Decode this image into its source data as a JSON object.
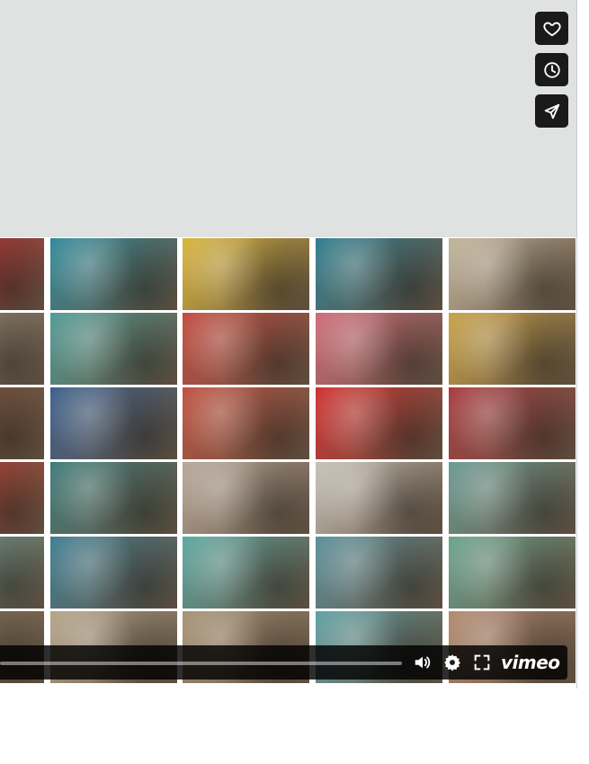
{
  "player": {
    "side_actions": [
      {
        "name": "like",
        "icon": "heart-icon"
      },
      {
        "name": "watch-later",
        "icon": "clock-icon"
      },
      {
        "name": "share",
        "icon": "paper-plane-icon"
      }
    ],
    "controls": {
      "progress_fraction": 0.0,
      "icons": [
        "volume-icon",
        "gear-icon",
        "fullscreen-icon"
      ],
      "brand_logo": "vimeo"
    },
    "thumbnail_colors": [
      [
        "#c8252a",
        "#2f8a9a",
        "#d9b53a",
        "#2f7d8f",
        "#c2b59c"
      ],
      [
        "#9a8f80",
        "#4f9a94",
        "#c44a3e",
        "#cf6a78",
        "#c8a146"
      ],
      [
        "#7d4f3a",
        "#3a5f8c",
        "#c0503e",
        "#d0302f",
        "#a83a3f"
      ],
      [
        "#c73a2e",
        "#3d7a78",
        "#b8a89a",
        "#c7c2b8",
        "#6a9a92"
      ],
      [
        "#6fa7a1",
        "#3d7d92",
        "#5ba7a1",
        "#5a8f9a",
        "#6aa38f"
      ],
      [
        "#8c7a62",
        "#b5a58a",
        "#a89476",
        "#5fa0a4",
        "#b48a70"
      ]
    ]
  }
}
